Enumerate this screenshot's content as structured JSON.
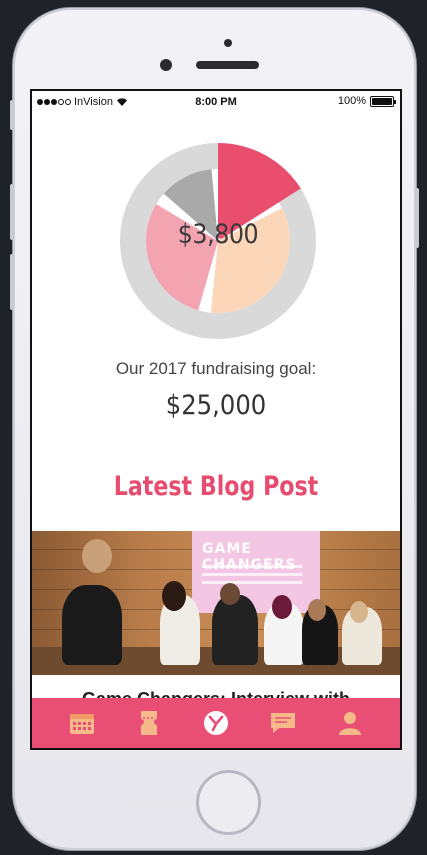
{
  "status_bar": {
    "carrier": "InVision",
    "time": "8:00 PM",
    "battery": "100%"
  },
  "fundraising": {
    "raised": "$3,800",
    "goal_label": "Our 2017 fundraising goal:",
    "goal_value": "$25,000"
  },
  "chart_data": {
    "type": "pie",
    "slices": [
      {
        "color": "#e94e6f",
        "value": 0.16
      },
      {
        "color": "#fcd6b8",
        "value": 0.37
      },
      {
        "color": "#f4a3b1",
        "value": 0.32
      },
      {
        "color": "#a9a9a9",
        "value": 0.15
      }
    ],
    "ring_color": "#d9d9d9"
  },
  "blog": {
    "section_title": "Latest Blog Post",
    "image_text": "GAME CHANGERS",
    "post_title": "Game Changers: Interview with"
  },
  "tabs": [
    {
      "icon": "calendar-icon"
    },
    {
      "icon": "ticket-icon"
    },
    {
      "icon": "home-logo-icon"
    },
    {
      "icon": "chat-icon"
    },
    {
      "icon": "profile-icon"
    }
  ],
  "colors": {
    "accent": "#e94e74",
    "tab_icon": "#f6b98a"
  }
}
